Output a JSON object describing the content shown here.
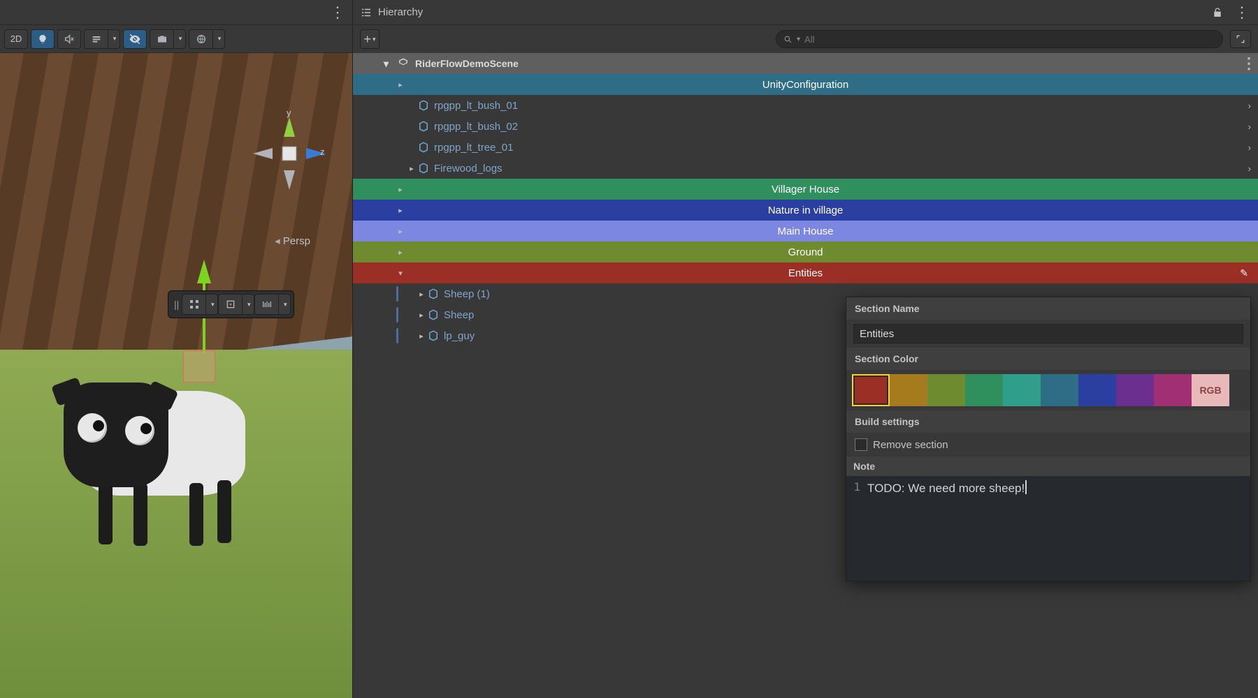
{
  "sceneToolbar": {
    "btn2D": "2D",
    "perspLabel": "Persp",
    "axisY": "y",
    "axisZ": "z"
  },
  "hierarchy": {
    "title": "Hierarchy",
    "searchPlaceholder": "All",
    "sceneName": "RiderFlowDemoScene",
    "rows": [
      {
        "label": "UnityConfiguration",
        "type": "group",
        "color": "blue1"
      },
      {
        "label": "rpgpp_lt_bush_01",
        "type": "prefab"
      },
      {
        "label": "rpgpp_lt_bush_02",
        "type": "prefab"
      },
      {
        "label": "rpgpp_lt_tree_01",
        "type": "prefab"
      },
      {
        "label": "Firewood_logs",
        "type": "prefab",
        "expandable": true
      },
      {
        "label": "Villager House",
        "type": "group",
        "color": "green1"
      },
      {
        "label": "Nature in village",
        "type": "group",
        "color": "indigo"
      },
      {
        "label": "Main House",
        "type": "group",
        "color": "lav"
      },
      {
        "label": "Ground",
        "type": "group",
        "color": "olive"
      },
      {
        "label": "Entities",
        "type": "group",
        "color": "maroon",
        "edit": true
      },
      {
        "label": "Sheep (1)",
        "type": "prefab",
        "child": true
      },
      {
        "label": "Sheep",
        "type": "prefab",
        "child": true
      },
      {
        "label": "lp_guy",
        "type": "prefab",
        "child": true
      }
    ]
  },
  "popover": {
    "sectionNameLabel": "Section Name",
    "sectionNameValue": "Entities",
    "sectionColorLabel": "Section Color",
    "colors": [
      "#9b2f26",
      "#a57b1e",
      "#6e8b2f",
      "#2f8f5d",
      "#2f9e8b",
      "#2e6d85",
      "#2b3fa0",
      "#6a2f8f",
      "#a12f74"
    ],
    "rgbLabel": "RGB",
    "buildSettingsLabel": "Build settings",
    "removeSectionLabel": "Remove section",
    "noteLabel": "Note",
    "noteLineNo": "1",
    "noteText": "TODO: We need more sheep!"
  }
}
